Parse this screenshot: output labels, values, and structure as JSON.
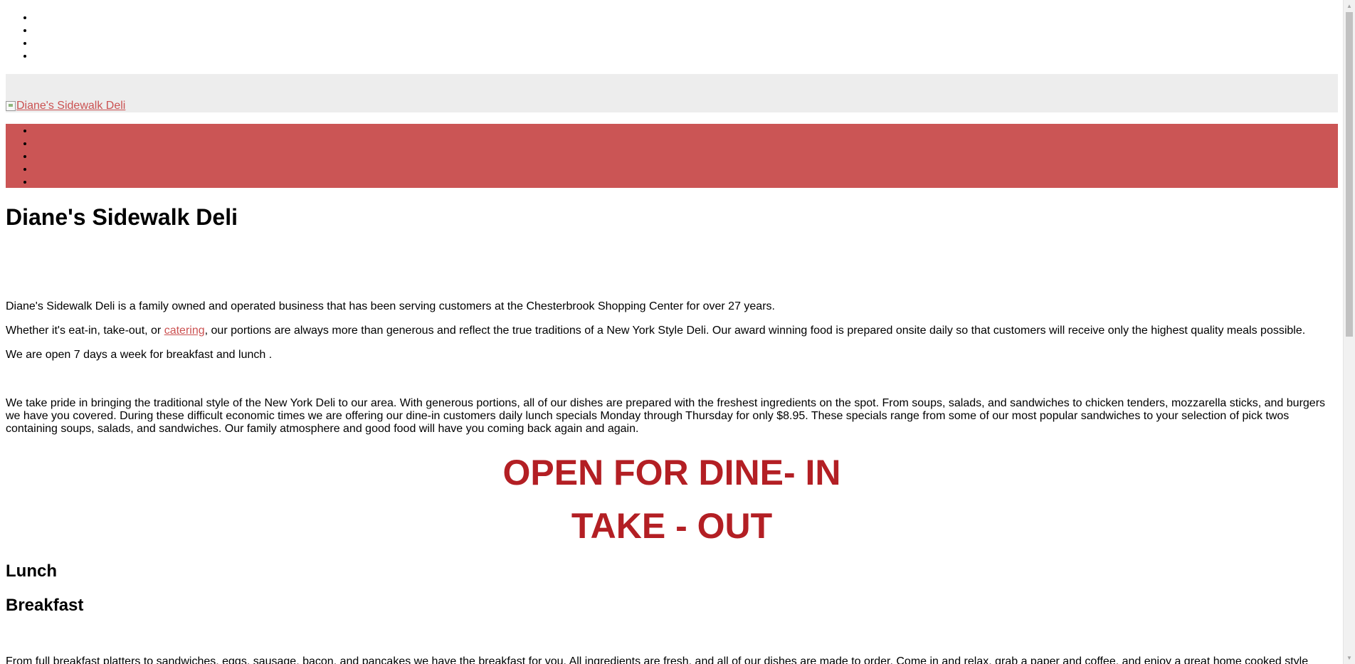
{
  "header": {
    "logo_alt": "Diane's Sidewalk Deli"
  },
  "main": {
    "title": "Diane's Sidewalk Deli",
    "intro": "Diane's Sidewalk Deli is a family owned and operated business that has been serving customers at the Chesterbrook Shopping Center for over 27 years.",
    "eat_before": "Whether it's eat-in, take-out, or ",
    "catering_link": "catering",
    "eat_after": ", our portions are always more than generous and reflect the true traditions of a New York Style Deli. Our award winning food is prepared onsite daily so that customers will receive only the highest quality meals possible.",
    "hours": "We are open 7 days a week for breakfast and lunch .",
    "pride": "We take pride in bringing the traditional style of the New York Deli to our area. With generous portions, all of our dishes are prepared with the freshest ingredients on the spot. From soups, salads, and sandwiches to chicken tenders, mozzarella sticks, and burgers we have you covered. During these difficult economic times we are offering our dine-in customers daily lunch specials Monday through Thursday for only $8.95. These specials range from some of our most popular sandwiches to your selection of pick twos containing soups, salads, and sandwiches. Our family atmosphere and good food will have you coming back again and again.",
    "promo_line1": "OPEN FOR DINE- IN",
    "promo_line2": "TAKE - OUT",
    "lunch_heading": "Lunch",
    "breakfast_heading": "Breakfast",
    "breakfast_text": "From full breakfast platters to sandwiches, eggs, sausage, bacon, and pancakes we have the breakfast for you. All ingredients are fresh, and all of our dishes are made to order. Come in and relax, grab a paper and coffee, and enjoy a great home cooked style"
  },
  "colors": {
    "nav_background": "#cb5555",
    "header_background": "#ededed",
    "link": "#cb5151",
    "promo": "#b31f24"
  }
}
